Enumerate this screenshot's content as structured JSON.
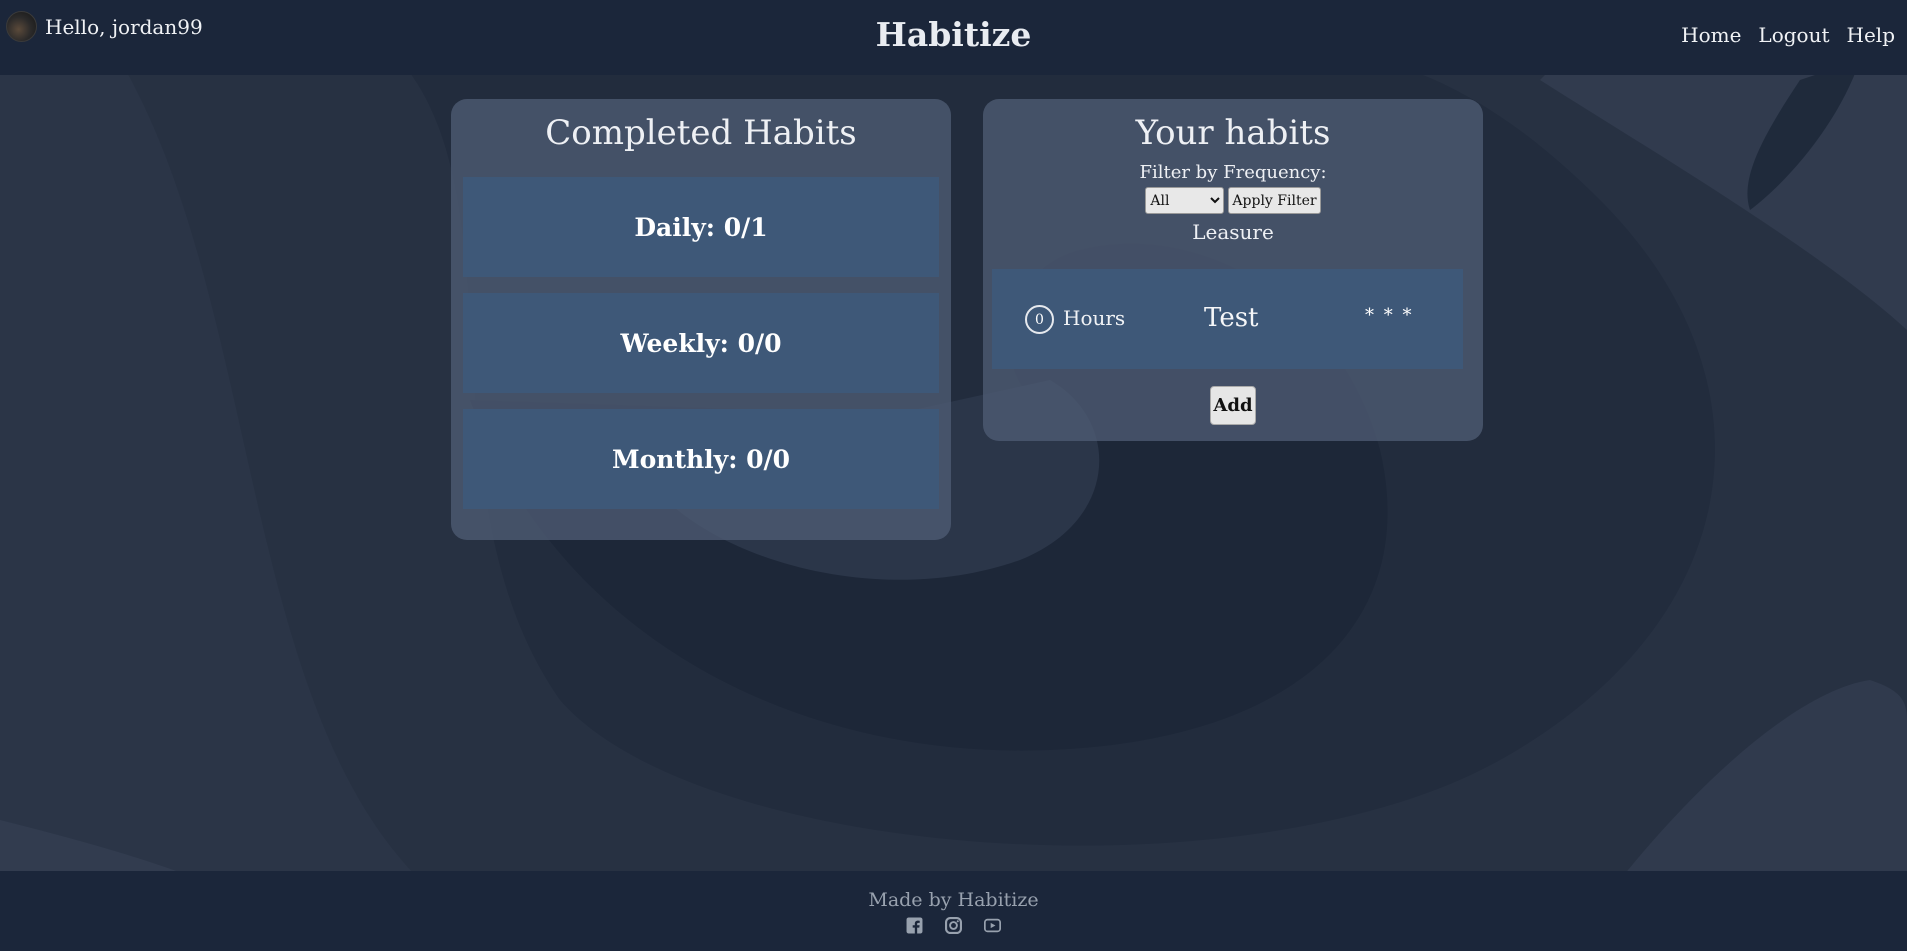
{
  "header": {
    "greeting": "Hello, jordan99",
    "brand": "Habitize",
    "nav": [
      "Home",
      "Logout",
      "Help"
    ]
  },
  "completed": {
    "title": "Completed Habits",
    "daily": "Daily: 0/1",
    "weekly": "Weekly: 0/0",
    "monthly": "Monthly: 0/0"
  },
  "habits": {
    "title": "Your habits",
    "filter_label": "Filter by Frequency:",
    "filter_selected": "All",
    "apply_label": "Apply Filter",
    "category": "Leasure",
    "items": [
      {
        "count": "0",
        "unit": "Hours",
        "name": "Test",
        "menu": "* * *"
      }
    ],
    "add_label": "Add"
  },
  "footer": {
    "text": "Made by Habitize",
    "icons": [
      "facebook-icon",
      "instagram-icon",
      "youtube-icon"
    ]
  },
  "colors": {
    "header_bg": "#1b263a",
    "page_bg": "#2a3445",
    "card_bg": "#3e5878"
  }
}
